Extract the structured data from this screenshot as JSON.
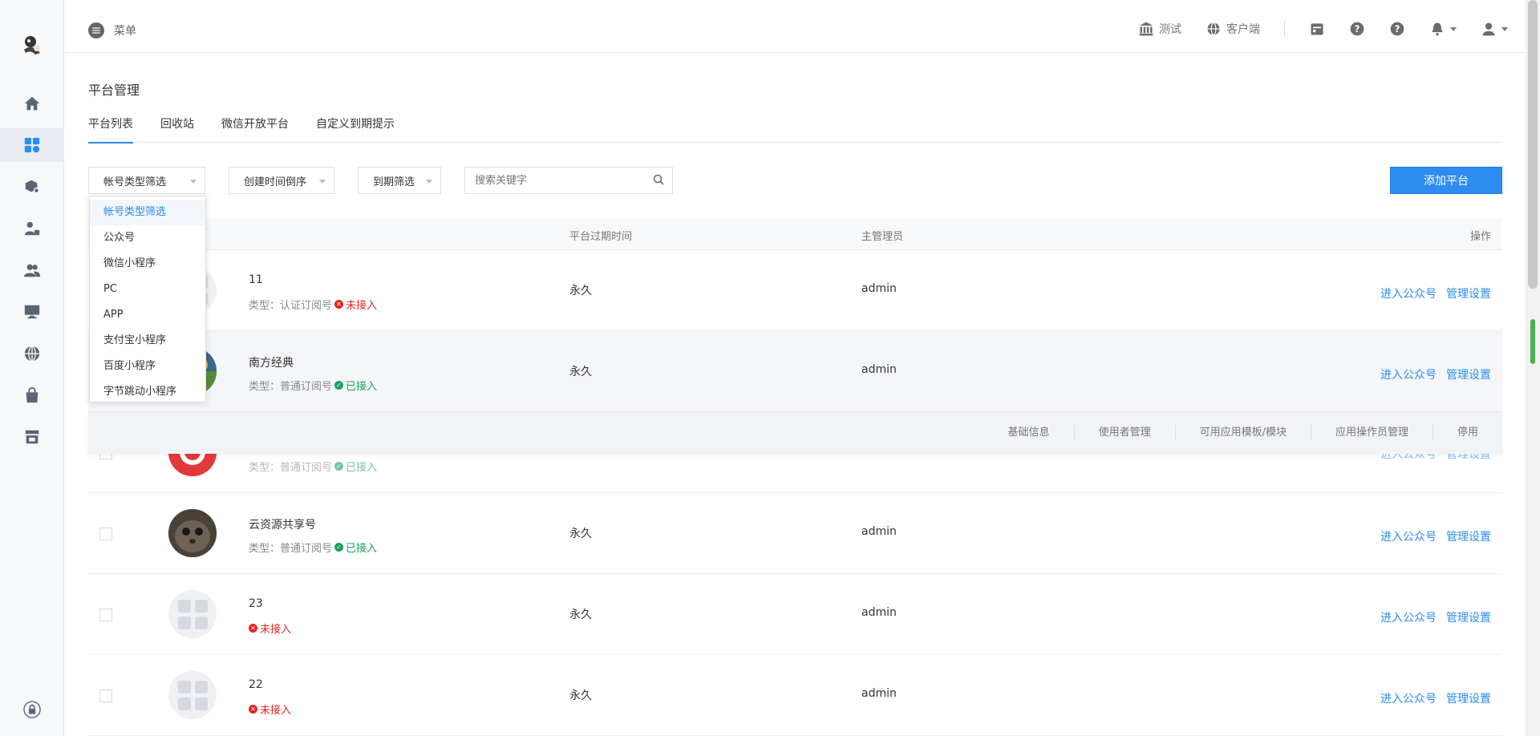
{
  "topbar": {
    "menu_label": "菜单",
    "right_items": [
      {
        "icon": "bank-icon",
        "label": "测试"
      },
      {
        "icon": "globe-icon",
        "label": "客户端"
      }
    ]
  },
  "page": {
    "title": "平台管理",
    "tabs": [
      "平台列表",
      "回收站",
      "微信开放平台",
      "自定义到期提示"
    ]
  },
  "filters": {
    "account_type": "帐号类型筛选",
    "sort": "创建时间倒序",
    "expire": "到期筛选",
    "search_placeholder": "搜索关键字",
    "add_button": "添加平台"
  },
  "dropdown": {
    "options": [
      "帐号类型筛选",
      "公众号",
      "微信小程序",
      "PC",
      "APP",
      "支付宝小程序",
      "百度小程序",
      "字节跳动小程序"
    ]
  },
  "table": {
    "headers": {
      "expire": "平台过期时间",
      "admin": "主管理员",
      "ops": "操作"
    },
    "rows": [
      {
        "name": "11",
        "type": "类型：认证订阅号",
        "status": "未接入",
        "status_ok": false,
        "expire": "永久",
        "admin": "admin",
        "op1": "进入公众号",
        "op2": "管理设置"
      },
      {
        "name": "南方经典",
        "type": "类型：普通订阅号",
        "status": "已接入",
        "status_ok": true,
        "expire": "永久",
        "admin": "admin",
        "op1": "进入公众号",
        "op2": "管理设置"
      },
      {
        "name": "",
        "type": "类型：普通订阅号",
        "status": "已接入",
        "status_ok": true,
        "expire": "",
        "admin": "",
        "op1": "进入公众号",
        "op2": "管理设置"
      },
      {
        "name": "云资源共享号",
        "type": "类型：普通订阅号",
        "status": "已接入",
        "status_ok": true,
        "expire": "永久",
        "admin": "admin",
        "op1": "进入公众号",
        "op2": "管理设置"
      },
      {
        "name": "23",
        "type": "",
        "status": "未接入",
        "status_ok": false,
        "expire": "永久",
        "admin": "admin",
        "op1": "进入公众号",
        "op2": "管理设置"
      },
      {
        "name": "22",
        "type": "",
        "status": "未接入",
        "status_ok": false,
        "expire": "永久",
        "admin": "admin",
        "op1": "进入公众号",
        "op2": "管理设置"
      }
    ],
    "subbar": [
      "基础信息",
      "使用者管理",
      "可用应用模板/模块",
      "应用操作员管理",
      "停用"
    ]
  }
}
